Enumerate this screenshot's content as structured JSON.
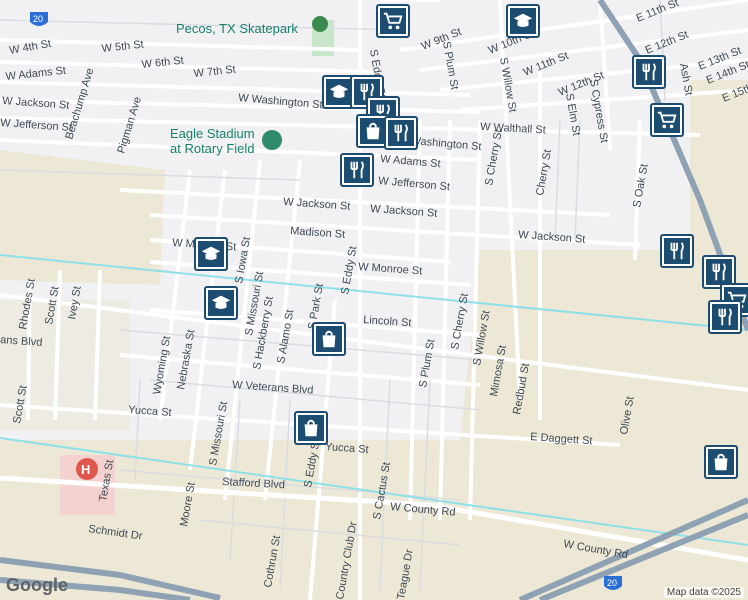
{
  "map": {
    "attribution": "Map data ©2025",
    "logo": "Google",
    "colors": {
      "background": "#f1f1f4",
      "street": "#ffffff",
      "minor_street": "#d9dce1",
      "land": "#ede8d5",
      "highway": "#8ea2b4",
      "rail": "#8fe0e8",
      "park": "#c8e6c9",
      "hospital_area": "#f3d2cf",
      "marker": "#1c4c70",
      "poi_text": "#16806a"
    },
    "street_labels": [
      "W 4th St",
      "W 5th St",
      "W 6th St",
      "W 7th St",
      "W Adams St",
      "W Jackson St",
      "W Jefferson St",
      "W Washington St",
      "Beachump Ave",
      "Pigman Ave",
      "W 9th St",
      "W 10th St",
      "W 11th St",
      "W 12th St",
      "E 11th St",
      "E 12th St",
      "E 13th St",
      "E 14th St",
      "E 15th St",
      "Walthall St",
      "W Walthall St",
      "E Washington St",
      "W Adams St",
      "W Jefferson St",
      "W Jackson St",
      "W Jackson St",
      "W Jackson St",
      "Madison St",
      "W Monroe St",
      "W Monroe St",
      "Lincoln St",
      "Lincoln St",
      "S Iowa St",
      "S Missouri St",
      "S Hackberry St",
      "S Alamo St",
      "S Park St",
      "S Eddy St",
      "S Eddy St",
      "S Plum St",
      "S Plum St",
      "S Cherry St",
      "S Cherry St",
      "S Willow St",
      "S Willow St",
      "S Elm St",
      "S Cypress St",
      "Cherry St",
      "S Oak St",
      "Ash St",
      "Mimosa St",
      "Redbud St",
      "Olive St",
      "E Daggett St",
      "Rhodes St",
      "Scott St",
      "Ivey St",
      "Scott St",
      "Wyoming St",
      "Nebraska St",
      "W Veterans Blvd",
      "ans Blvd",
      "Yucca St",
      "Yucca St",
      "S Missouri St",
      "S Eddy St",
      "Texas St",
      "Moore St",
      "Schmidt Dr",
      "Stafford Blvd",
      "W County Rd",
      "W County Rd",
      "S Cactus St",
      "Cothrun St",
      "Country Club Dr",
      "Teague Dr"
    ],
    "places": [
      {
        "name": "Pecos, TX Skatepark",
        "icon": "park-icon"
      },
      {
        "name": "Eagle Stadium at Rotary Field",
        "icon": "stadium-icon"
      },
      {
        "name": "Hospital",
        "icon": "hospital-icon"
      }
    ],
    "highway_shields": [
      "20",
      "20"
    ],
    "markers": [
      {
        "icon": "grocery-cart-icon"
      },
      {
        "icon": "school-icon"
      },
      {
        "icon": "school-icon"
      },
      {
        "icon": "restaurant-icon"
      },
      {
        "icon": "school-icon"
      },
      {
        "icon": "restaurant-icon"
      },
      {
        "icon": "restaurant-icon"
      },
      {
        "icon": "shopping-bag-icon"
      },
      {
        "icon": "restaurant-icon"
      },
      {
        "icon": "restaurant-icon"
      },
      {
        "icon": "grocery-cart-icon"
      },
      {
        "icon": "restaurant-icon"
      },
      {
        "icon": "restaurant-icon"
      },
      {
        "icon": "grocery-cart-icon"
      },
      {
        "icon": "restaurant-icon"
      },
      {
        "icon": "school-icon"
      },
      {
        "icon": "school-icon"
      },
      {
        "icon": "shopping-bag-icon"
      },
      {
        "icon": "shopping-bag-icon"
      },
      {
        "icon": "shopping-bag-icon"
      }
    ]
  }
}
